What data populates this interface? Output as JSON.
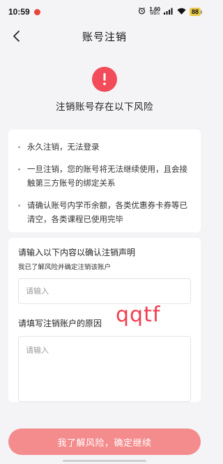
{
  "status_bar": {
    "time": "10:59",
    "net_speed_value": "1.60",
    "net_speed_unit": "MB/s",
    "battery": "88",
    "icons": [
      "app-notification-icon",
      "alarm-icon",
      "signal-icon",
      "wifi-icon",
      "battery-icon"
    ]
  },
  "nav": {
    "back_icon": "chevron-left-icon",
    "title": "账号注销"
  },
  "warning": {
    "icon": "exclamation-icon",
    "color": "#f24b59",
    "title": "注销账号存在以下风险"
  },
  "risks": [
    {
      "text": "永久注销，无法登录"
    },
    {
      "text": "一旦注销，您的账号将无法继续使用，且会接触第三方账号的绑定关系"
    },
    {
      "text": "请确认账号内学币余额，各类优惠券卡券等已清空，各类课程已使用完毕"
    }
  ],
  "form": {
    "statement_label": "请输入以下内容以确认注销声明",
    "statement_hint": "我已了解风险并确定注销该账户",
    "statement_placeholder": "请输入",
    "reason_label": "请填写注销账户的原因",
    "reason_placeholder": "请输入"
  },
  "watermark": "qqtf",
  "confirm_button": {
    "label": "我了解风险，确定继续",
    "color": "#f48b8d"
  }
}
